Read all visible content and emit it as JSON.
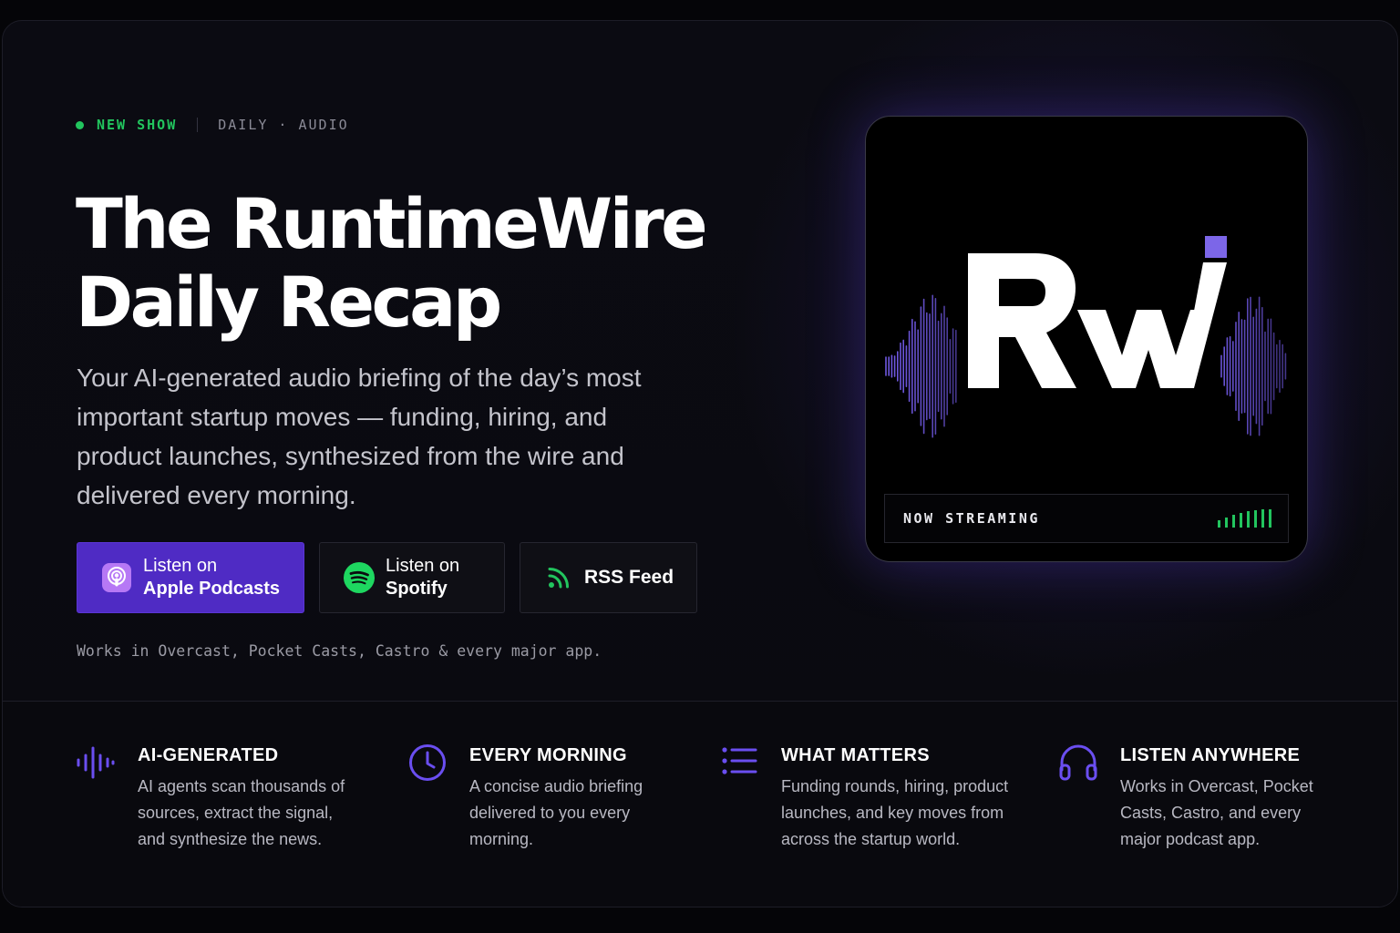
{
  "hero": {
    "badge": "NEW SHOW",
    "meta": "DAILY · AUDIO",
    "title_line1": "The RuntimeWire",
    "title_line2": "Daily Recap",
    "description": "Your AI-generated audio briefing of the day’s most important startup moves — funding, hiring, and product launches, synthesized from the wire and delivered every morning.",
    "buttons": {
      "apple": {
        "line1": "Listen on",
        "line2": "Apple Podcasts",
        "icon": "apple-podcasts-icon"
      },
      "spotify": {
        "line1": "Listen on",
        "line2": "Spotify",
        "icon": "spotify-icon"
      },
      "rss": {
        "label": "RSS Feed",
        "icon": "rss-icon"
      }
    },
    "works_note": "Works in Overcast, Pocket Casts, Castro & every major app."
  },
  "artwork": {
    "logo_text": "Rw",
    "status": "NOW STREAMING",
    "accent": "#7c66e8"
  },
  "features": [
    {
      "icon": "waveform-icon",
      "title": "AI-GENERATED",
      "lines": [
        "AI agents scan thousands of",
        "sources, extract the signal,",
        "and synthesize the news."
      ]
    },
    {
      "icon": "clock-icon",
      "title": "EVERY MORNING",
      "lines": [
        "A concise audio briefing",
        "delivered to you every",
        "morning."
      ]
    },
    {
      "icon": "list-icon",
      "title": "WHAT MATTERS",
      "lines": [
        "Funding rounds, hiring, product",
        "launches, and key moves from",
        "across the startup world."
      ]
    },
    {
      "icon": "headphones-icon",
      "title": "LISTEN ANYWHERE",
      "lines": [
        "Works in Overcast, Pocket",
        "Casts, Castro, and every",
        "major podcast app."
      ]
    }
  ],
  "colors": {
    "accent_purple": "#5a3fd8",
    "button_purple": "#4f2bc4",
    "live_green": "#22c55e",
    "spotify_green": "#1ed760"
  }
}
